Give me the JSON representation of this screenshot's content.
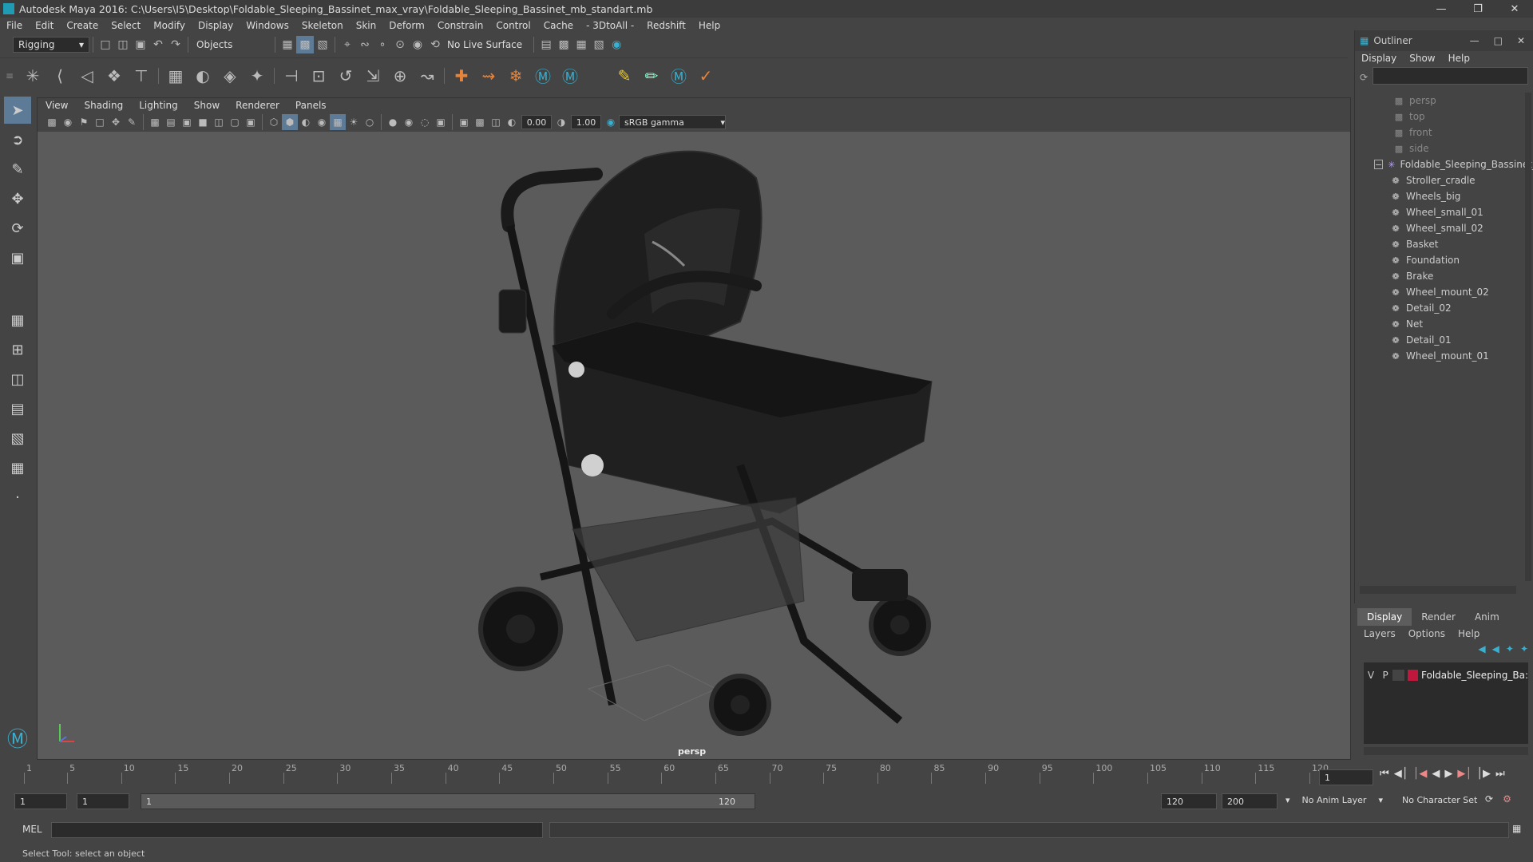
{
  "window": {
    "title": "Autodesk Maya 2016: C:\\Users\\I5\\Desktop\\Foldable_Sleeping_Bassinet_max_vray\\Foldable_Sleeping_Bassinet_mb_standart.mb"
  },
  "menu": [
    "File",
    "Edit",
    "Create",
    "Select",
    "Modify",
    "Display",
    "Windows",
    "Skeleton",
    "Skin",
    "Deform",
    "Constrain",
    "Control",
    "Cache",
    "- 3DtoAll -",
    "Redshift",
    "Help"
  ],
  "status": {
    "mode": "Rigging",
    "selection_mode": "Objects",
    "live_surface": "No Live Surface"
  },
  "viewport": {
    "menu": [
      "View",
      "Shading",
      "Lighting",
      "Show",
      "Renderer",
      "Panels"
    ],
    "exposure": "0.00",
    "gamma": "1.00",
    "color_space": "sRGB gamma",
    "camera_label": "persp"
  },
  "outliner": {
    "title": "Outliner",
    "menu": [
      "Display",
      "Show",
      "Help"
    ],
    "cameras": [
      "persp",
      "top",
      "front",
      "side"
    ],
    "group": "Foldable_Sleeping_Bassinet_",
    "children": [
      "Stroller_cradle",
      "Wheels_big",
      "Wheel_small_01",
      "Wheel_small_02",
      "Basket",
      "Foundation",
      "Brake",
      "Wheel_mount_02",
      "Detail_02",
      "Net",
      "Detail_01",
      "Wheel_mount_01"
    ]
  },
  "layers": {
    "tabs": [
      "Display",
      "Render",
      "Anim"
    ],
    "active_tab": "Display",
    "menu": [
      "Layers",
      "Options",
      "Help"
    ],
    "layer": {
      "v": "V",
      "p": "P",
      "name": "Foldable_Sleeping_Ba:",
      "color": "#c0183c"
    }
  },
  "timeline": {
    "ticks": [
      "1",
      "5",
      "10",
      "15",
      "20",
      "25",
      "30",
      "35",
      "40",
      "45",
      "50",
      "55",
      "60",
      "65",
      "70",
      "75",
      "80",
      "85",
      "90",
      "95",
      "100",
      "105",
      "110",
      "115",
      "120"
    ],
    "current_frame": "1"
  },
  "range": {
    "start": "1",
    "playback_start": "1",
    "range_start": "1",
    "range_end": "120",
    "playback_end": "120",
    "end": "200",
    "anim_layer": "No Anim Layer",
    "character_set": "No Character Set"
  },
  "command": {
    "lang": "MEL"
  },
  "help": {
    "text": "Select Tool: select an object"
  }
}
